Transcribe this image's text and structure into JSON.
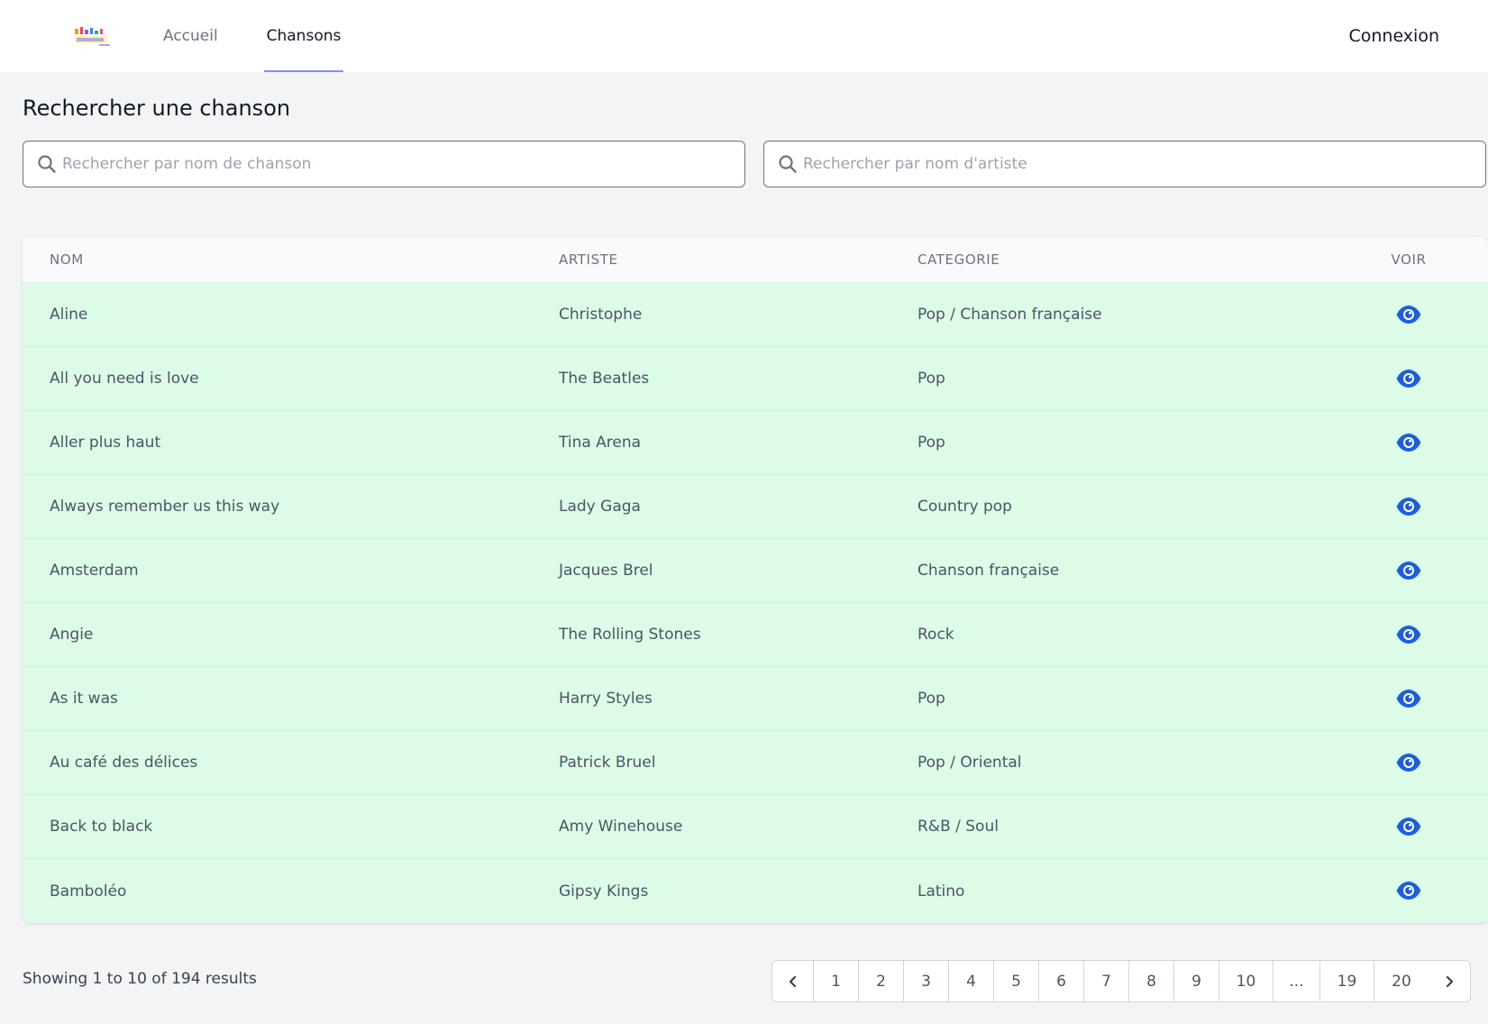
{
  "header": {
    "logo_alt": "MusiCol",
    "nav": [
      {
        "label": "Accueil"
      },
      {
        "label": "Chansons"
      }
    ],
    "login_label": "Connexion",
    "active_color": "#818cf8"
  },
  "search": {
    "title": "Rechercher une chanson",
    "song_placeholder": "Rechercher par nom de chanson",
    "artist_placeholder": "Rechercher par nom d'artiste"
  },
  "table": {
    "headers": [
      "NOM",
      "ARTISTE",
      "CATEGORIE",
      "VOIR"
    ],
    "rows": [
      {
        "nom": "Aline",
        "artiste": "Christophe",
        "categorie": "Pop / Chanson française"
      },
      {
        "nom": "All you need is love",
        "artiste": "The Beatles",
        "categorie": "Pop"
      },
      {
        "nom": "Aller plus haut",
        "artiste": "Tina Arena",
        "categorie": "Pop"
      },
      {
        "nom": "Always remember us this way",
        "artiste": "Lady Gaga",
        "categorie": "Country pop"
      },
      {
        "nom": "Amsterdam",
        "artiste": "Jacques Brel",
        "categorie": "Chanson française"
      },
      {
        "nom": "Angie",
        "artiste": "The Rolling Stones",
        "categorie": "Rock"
      },
      {
        "nom": "As it was",
        "artiste": "Harry Styles",
        "categorie": "Pop"
      },
      {
        "nom": "Au café des délices",
        "artiste": "Patrick Bruel",
        "categorie": "Pop / Oriental"
      },
      {
        "nom": "Back to black",
        "artiste": "Amy Winehouse",
        "categorie": "R&B / Soul"
      },
      {
        "nom": "Bamboléo",
        "artiste": "Gipsy Kings",
        "categorie": "Latino"
      }
    ],
    "row_color": "#dcfce7",
    "eye_icon_color": "#1d5fd6"
  },
  "footer": {
    "showing_text": "Showing 1 to 10 of 194 results",
    "pages": [
      "1",
      "2",
      "3",
      "4",
      "5",
      "6",
      "7",
      "8",
      "9",
      "10",
      "...",
      "19",
      "20"
    ]
  }
}
